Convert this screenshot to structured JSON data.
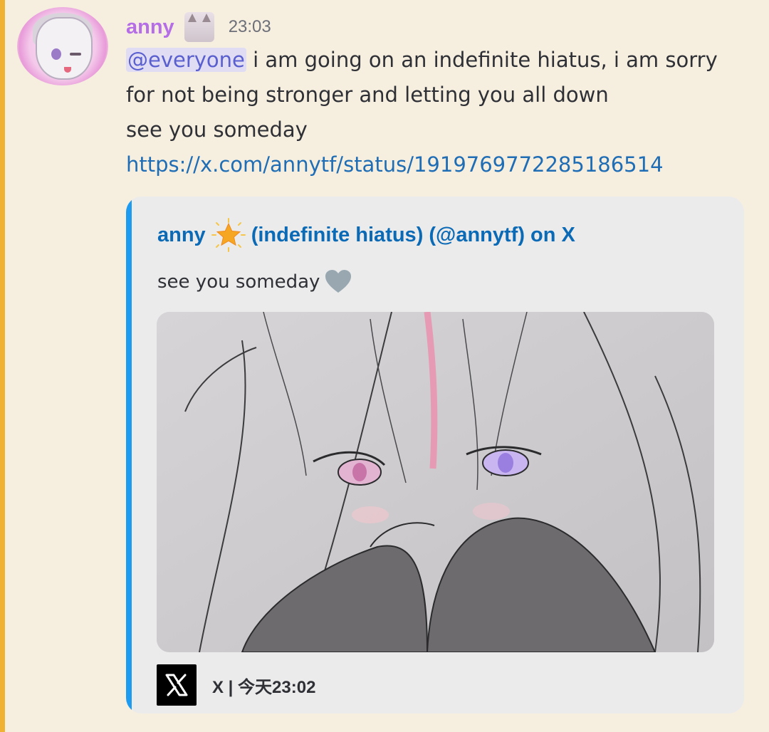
{
  "message": {
    "author": "anny",
    "timestamp": "23:03",
    "mention": "@everyone",
    "line1_rest": " i am going on an indefinite hiatus, i am sorry",
    "line2": "for not being stronger and letting you all down",
    "line3": "see you someday",
    "link": "https://x.com/annytf/status/1919769772285186514"
  },
  "embed": {
    "author_name": "anny",
    "author_suffix": "(indefinite hiatus) (@annytf) on X",
    "description": "see you someday",
    "footer": "X | 今天23:02",
    "accent_color": "#1d9bf0"
  },
  "icons": {
    "role_icon": "cat-girl-icon",
    "author_emoji": "glowing-star-icon",
    "description_emoji": "grey-heart-icon",
    "footer_icon": "x-logo-icon"
  },
  "colors": {
    "username": "#b56ee6",
    "mention_bg": "#e0dcf3",
    "mention_text": "#5a5fcf",
    "link": "#1f6db4",
    "mention_highlight_bar": "#f0b232"
  }
}
